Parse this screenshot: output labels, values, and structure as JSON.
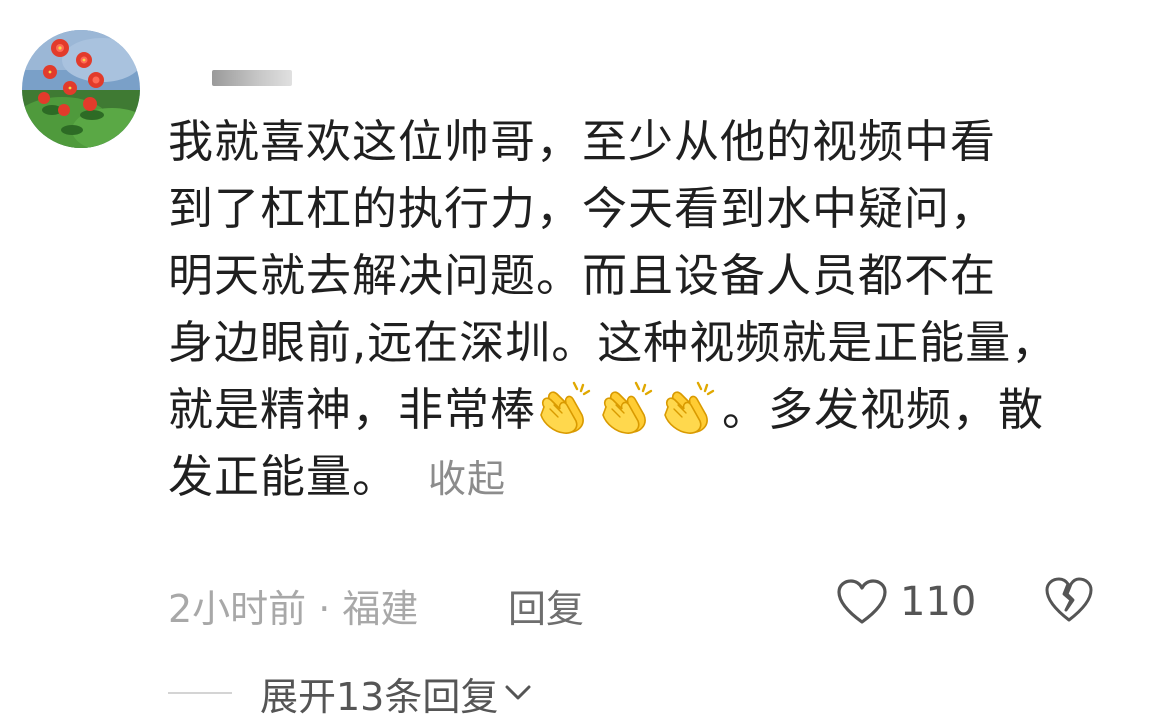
{
  "comment": {
    "lines": [
      "我就喜欢这位帅哥，至少从他的视频中看",
      "到了杠杠的执行力，今天看到水中疑问，",
      "明天就去解决问题。而且设备人员都不在",
      "身边眼前,远在深圳。这种视频就是正能量，"
    ],
    "line5_before": "就是精神，非常棒",
    "line5_after": "。多发视频，散",
    "line6": "发正能量。",
    "collapse_label": "收起",
    "emoji_icon": "clapping-hands-icon",
    "emoji_count": 3
  },
  "meta": {
    "time_location": "2小时前 · 福建",
    "reply_label": "回复",
    "like_count": "110"
  },
  "replies": {
    "expand_label": "展开13条回复"
  },
  "colors": {
    "body_text": "#1f1f1f",
    "muted": "#a8a8a8",
    "link": "#8c8c8c"
  }
}
